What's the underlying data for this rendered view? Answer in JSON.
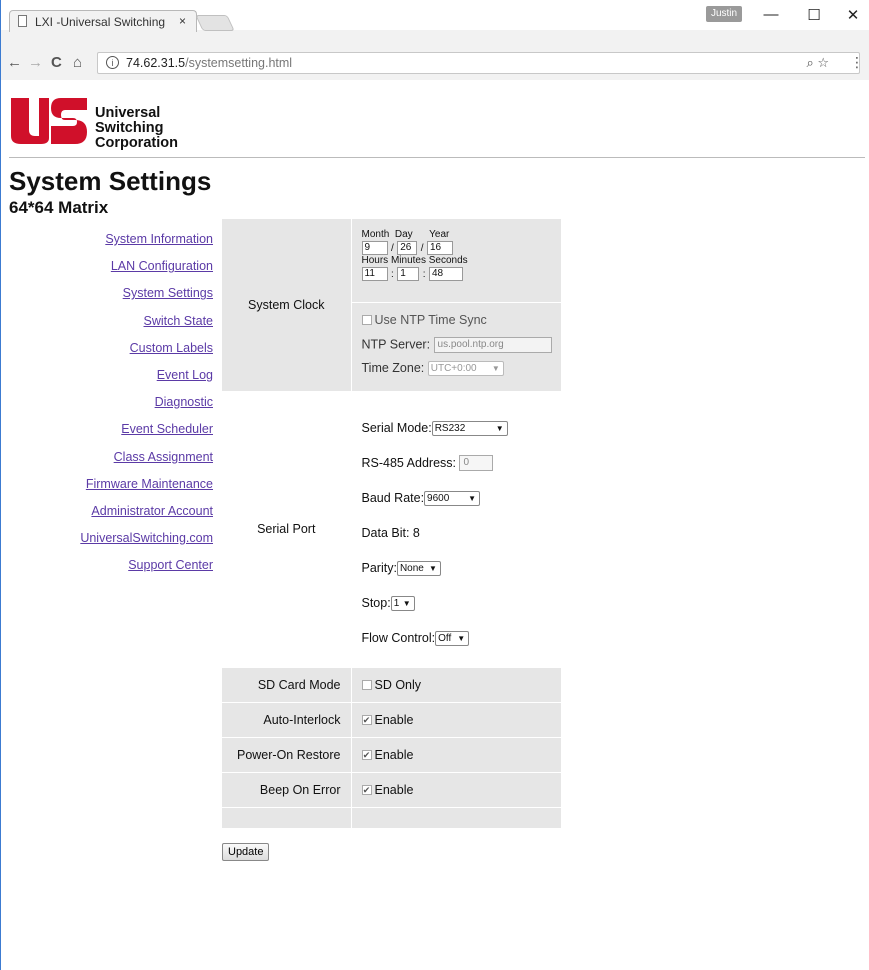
{
  "browser": {
    "tab_title": "LXI -Universal Switching",
    "tab_close": "×",
    "profile": "Justin",
    "url_host": "74.62.31.5",
    "url_path": "/systemsetting.html",
    "buttons": {
      "back": "←",
      "forward": "→",
      "reload": "C",
      "home": "⌂",
      "minimize": "—",
      "maximize": "☐",
      "close": "✕",
      "zoom": "🔍",
      "star": "☆",
      "menu": "⋮"
    }
  },
  "logo": {
    "line1": "Universal",
    "line2": "Switching",
    "line3": "Corporation",
    "accent_color": "#d0102a"
  },
  "page": {
    "title": "System Settings",
    "subtitle": "64*64 Matrix"
  },
  "nav": [
    "System Information",
    "LAN Configuration",
    "System Settings",
    "Switch State",
    "Custom Labels",
    "Event Log",
    "Diagnostic",
    "Event Scheduler",
    "Class Assignment",
    "Firmware Maintenance",
    "Administrator Account",
    "UniversalSwitching.com",
    "Support Center"
  ],
  "clock": {
    "label": "System Clock",
    "month_label": "Month",
    "day_label": "Day",
    "year_label": "Year",
    "month": "9",
    "day": "26",
    "year": "16",
    "date_sep": "/",
    "hours_label": "Hours",
    "minutes_label": "Minutes",
    "seconds_label": "Seconds",
    "hours": "11",
    "minutes": "1",
    "seconds": "48",
    "time_sep": ":",
    "ntp_label": "Use NTP Time Sync",
    "ntp_server_label": "NTP Server:",
    "ntp_server": "us.pool.ntp.org",
    "timezone_label": "Time Zone:",
    "timezone": "UTC+0:00"
  },
  "serial": {
    "label": "Serial Port",
    "mode_label": "Serial Mode:",
    "mode": "RS232",
    "address_label": "RS-485 Address:",
    "address": "0",
    "baud_label": "Baud Rate:",
    "baud": "9600",
    "databit_label": "Data Bit: 8",
    "parity_label": "Parity:",
    "parity": "None",
    "stop_label": "Stop:",
    "stop": "1",
    "flow_label": "Flow Control:",
    "flow": "Off"
  },
  "options": {
    "sd_label": "SD Card Mode",
    "sd_value": "SD Only",
    "interlock_label": "Auto-Interlock",
    "interlock_value": "Enable",
    "restore_label": "Power-On Restore",
    "restore_value": "Enable",
    "beep_label": "Beep On Error",
    "beep_value": "Enable"
  },
  "update_button": "Update"
}
